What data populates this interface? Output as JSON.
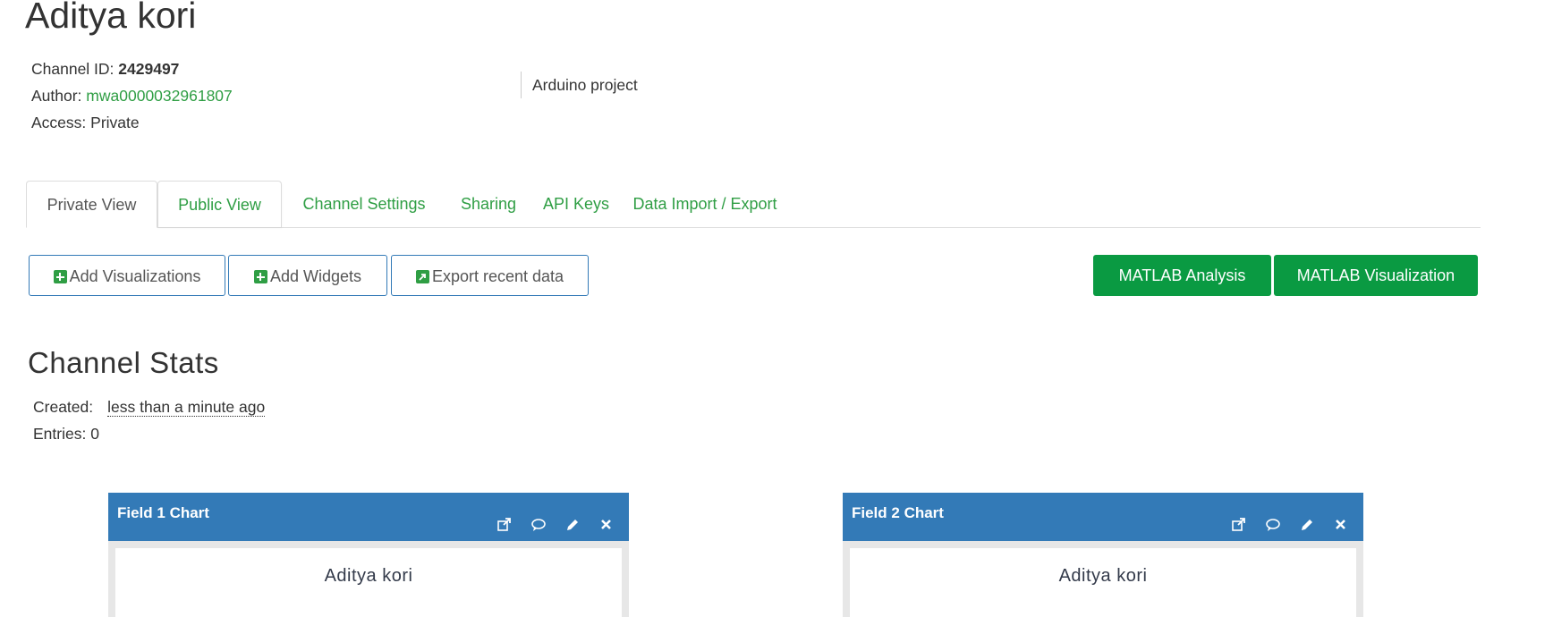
{
  "channel": {
    "title": "Aditya kori",
    "id_label": "Channel ID: ",
    "id_value": "2429497",
    "author_label": "Author: ",
    "author_value": "mwa0000032961807",
    "access_label": "Access: ",
    "access_value": "Private",
    "description": "Arduino project"
  },
  "tabs": [
    {
      "label": "Private View"
    },
    {
      "label": "Public View"
    },
    {
      "label": "Channel Settings"
    },
    {
      "label": "Sharing"
    },
    {
      "label": "API Keys"
    },
    {
      "label": "Data Import / Export"
    }
  ],
  "actions": {
    "add_visualizations": "Add Visualizations",
    "add_widgets": "Add Widgets",
    "export_recent": "Export recent data",
    "matlab_analysis": "MATLAB Analysis",
    "matlab_visualization": "MATLAB Visualization"
  },
  "stats": {
    "title": "Channel Stats",
    "created_label": "Created:",
    "created_value": "less than a minute ago",
    "entries_label": "Entries: ",
    "entries_value": "0"
  },
  "charts": [
    {
      "header": "Field 1 Chart",
      "chart_title": "Aditya kori"
    },
    {
      "header": "Field 2 Chart",
      "chart_title": "Aditya kori"
    }
  ],
  "colors": {
    "link_green": "#2f9e44",
    "button_green": "#0a9a42",
    "header_blue": "#337ab7"
  },
  "icons": [
    "plus-square-icon",
    "export-icon",
    "external-link-icon",
    "comment-icon",
    "pencil-icon",
    "close-icon"
  ]
}
